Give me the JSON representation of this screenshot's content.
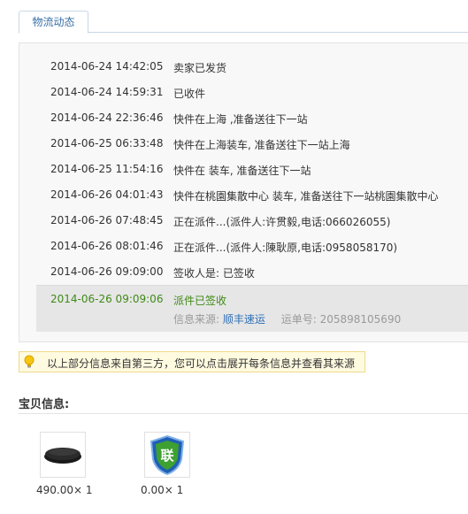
{
  "tab": {
    "label": "物流动态"
  },
  "timeline": [
    {
      "time": "2014-06-24 14:42:05",
      "desc": "卖家已发货"
    },
    {
      "time": "2014-06-24 14:59:31",
      "desc": "已收件"
    },
    {
      "time": "2014-06-24 22:36:46",
      "desc": "快件在上海 ,准备送往下一站"
    },
    {
      "time": "2014-06-25 06:33:48",
      "desc": "快件在上海装车, 准备送往下一站上海"
    },
    {
      "time": "2014-06-25 11:54:16",
      "desc": "快件在 装车, 准备送往下一站"
    },
    {
      "time": "2014-06-26 04:01:43",
      "desc": "快件在桃園集散中心 装车, 准备送往下一站桃園集散中心"
    },
    {
      "time": "2014-06-26 07:48:45",
      "desc": "正在派件...(派件人:许贯毅,电话:066026055)"
    },
    {
      "time": "2014-06-26 08:01:46",
      "desc": "正在派件...(派件人:陳耿原,电话:0958058170)"
    },
    {
      "time": "2014-06-26 09:09:00",
      "desc": "签收人是: 已签收"
    }
  ],
  "latest": {
    "time": "2014-06-26 09:09:06",
    "desc": "派件已签收",
    "source_label": "信息来源:",
    "source_name": "顺丰速运",
    "tracking_label": "运单号:",
    "tracking_number": "205898105690"
  },
  "notice": {
    "icon": "lightbulb-icon",
    "text": "以上部分信息来自第三方，您可以点击展开每条信息并查看其来源"
  },
  "products_section": {
    "title": "宝贝信息:",
    "items": [
      {
        "image": "tv-box-image",
        "price": "490.00× 1"
      },
      {
        "image": "union-shield-badge",
        "badge_text": "联",
        "price": "0.00× 1"
      }
    ]
  },
  "colors": {
    "link": "#2f6fb7",
    "latest_green": "#3f8a17",
    "notice_bg": "#fffbe0",
    "panel_bg": "#f8f8f8"
  }
}
